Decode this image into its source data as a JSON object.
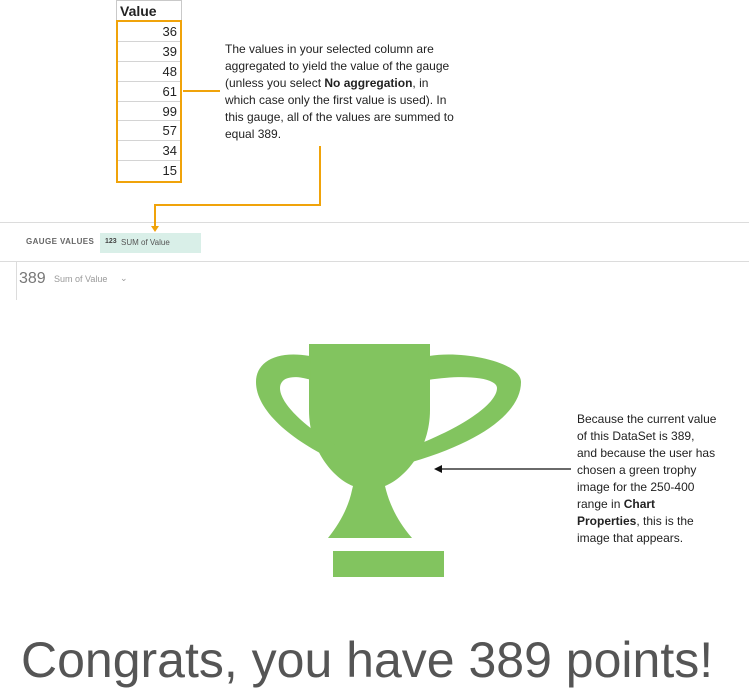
{
  "sheet": {
    "header": "Value",
    "values": [
      "36",
      "39",
      "48",
      "61",
      "99",
      "57",
      "34",
      "15"
    ]
  },
  "note_aggregation": {
    "part1": "The values in your selected column are aggregated to yield the value of the gauge (unless you select ",
    "bold": "No aggregation",
    "part2": ", in which case only the first value is used). In this gauge, all of the values are summed to equal 389."
  },
  "gauge_values": {
    "label": "GAUGE VALUES",
    "chip_type": "123",
    "chip_text": "SUM of Value"
  },
  "value_row": {
    "value": "389",
    "label": "Sum of Value",
    "chevron": "⌄"
  },
  "note_trophy": {
    "part1": "Because the current value of this DataSet is 389, and because the user has chosen a green trophy image for the 250-400 range in ",
    "bold": "Chart Properties",
    "part2": ", this is the image that appears."
  },
  "trophy": {
    "icon": "trophy-icon",
    "color": "#82c45f"
  },
  "accent": "#f0a30a",
  "congrats": "Congrats, you have 389 points!"
}
